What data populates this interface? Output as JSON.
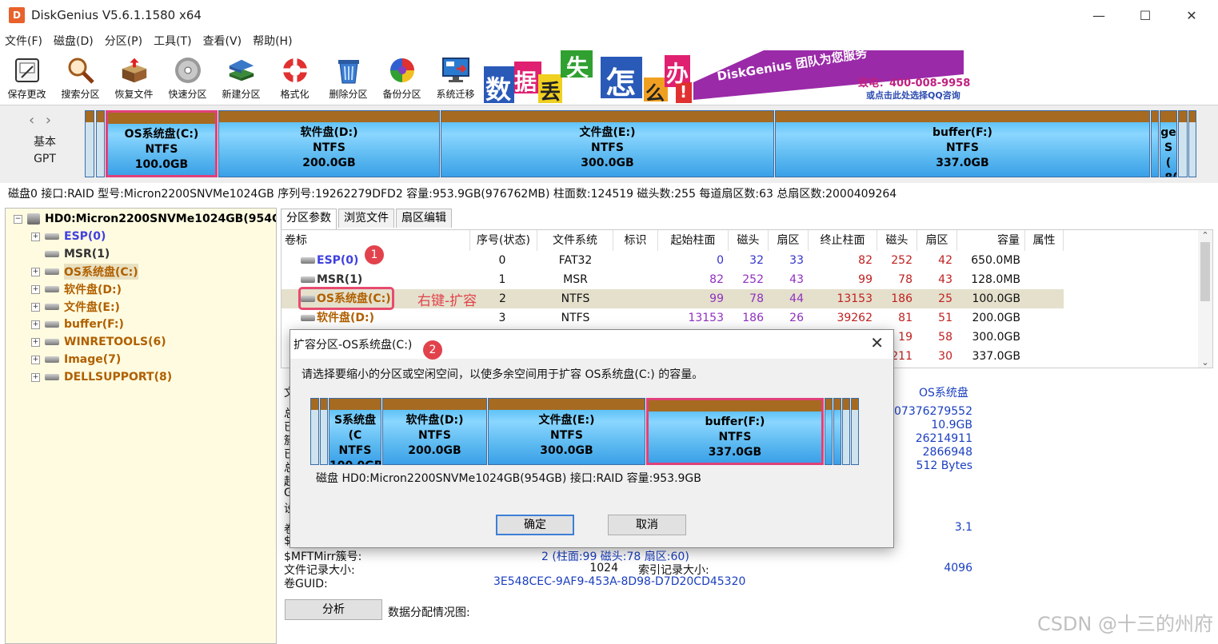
{
  "window": {
    "title": "DiskGenius V5.6.1.1580 x64",
    "logo": "D",
    "controls": [
      "—",
      "☐",
      "✕"
    ]
  },
  "menu": [
    "文件(F)",
    "磁盘(D)",
    "分区(P)",
    "工具(T)",
    "查看(V)",
    "帮助(H)"
  ],
  "toolbar": [
    {
      "label": "保存更改",
      "icon": "save-icon"
    },
    {
      "label": "搜索分区",
      "icon": "magnifier-icon"
    },
    {
      "label": "恢复文件",
      "icon": "restore-box-icon"
    },
    {
      "label": "快速分区",
      "icon": "disc-icon"
    },
    {
      "label": "新建分区",
      "icon": "layers-icon"
    },
    {
      "label": "格式化",
      "icon": "lifebuoy-icon"
    },
    {
      "label": "删除分区",
      "icon": "trash-icon"
    },
    {
      "label": "备份分区",
      "icon": "pie-chart-icon"
    },
    {
      "label": "系统迁移",
      "icon": "monitor-icon"
    }
  ],
  "banner": {
    "chars": [
      "数",
      "据",
      "丢",
      "失",
      "怎",
      "么",
      "办",
      "!"
    ],
    "slogan": "DiskGenius 团队为您服务",
    "phone": "致电：400-008-9958",
    "qq": "或点击此处选择QQ咨询"
  },
  "diskmap": {
    "type_line1": "基本",
    "type_line2": "GPT",
    "partitions": [
      {
        "name": "OS系统盘(C:)",
        "fs": "NTFS",
        "size": "100.0GB"
      },
      {
        "name": "软件盘(D:)",
        "fs": "NTFS",
        "size": "200.0GB"
      },
      {
        "name": "文件盘(E:)",
        "fs": "NTFS",
        "size": "300.0GB"
      },
      {
        "name": "buffer(F:)",
        "fs": "NTFS",
        "size": "337.0GB"
      },
      {
        "name": "ge",
        "fs": "S (",
        "size": ".8("
      }
    ]
  },
  "diskinfo": "磁盘0 接口:RAID  型号:Micron2200SNVMe1024GB  序列号:19262279DFD2  容量:953.9GB(976762MB)  柱面数:124519  磁头数:255  每道扇区数:63  总扇区数:2000409264",
  "tree": {
    "root": "HD0:Micron2200SNVMe1024GB(954G",
    "items": [
      {
        "label": "ESP(0)",
        "color": "#4040e0"
      },
      {
        "label": "MSR(1)",
        "color": "#333333"
      },
      {
        "label": "OS系统盘(C:)",
        "color": "#b06000"
      },
      {
        "label": "软件盘(D:)",
        "color": "#b06000"
      },
      {
        "label": "文件盘(E:)",
        "color": "#b06000"
      },
      {
        "label": "buffer(F:)",
        "color": "#b06000"
      },
      {
        "label": "WINRETOOLS(6)",
        "color": "#b06000"
      },
      {
        "label": "Image(7)",
        "color": "#b06000"
      },
      {
        "label": "DELLSUPPORT(8)",
        "color": "#b06000"
      }
    ]
  },
  "tabs": [
    "分区参数",
    "浏览文件",
    "扇区编辑"
  ],
  "partlist": {
    "headers": [
      "卷标",
      "序号(状态)",
      "文件系统",
      "标识",
      "起始柱面",
      "磁头",
      "扇区",
      "终止柱面",
      "磁头",
      "扇区",
      "容量",
      "属性"
    ],
    "rows": [
      {
        "label": "ESP(0)",
        "color": "#4040e0",
        "idx": "0",
        "fs": "FAT32",
        "sc": "0",
        "sh": "32",
        "ss": "33",
        "ec": "82",
        "eh": "252",
        "es": "42",
        "cap": "650.0MB"
      },
      {
        "label": "MSR(1)",
        "color": "#333333",
        "idx": "1",
        "fs": "MSR",
        "sc": "82",
        "sh": "252",
        "ss": "43",
        "ec": "99",
        "eh": "78",
        "es": "43",
        "cap": "128.0MB"
      },
      {
        "label": "OS系统盘(C:)",
        "color": "#b06000",
        "idx": "2",
        "fs": "NTFS",
        "sc": "99",
        "sh": "78",
        "ss": "44",
        "ec": "13153",
        "eh": "186",
        "es": "25",
        "cap": "100.0GB"
      },
      {
        "label": "软件盘(D:)",
        "color": "#b06000",
        "idx": "3",
        "fs": "NTFS",
        "sc": "13153",
        "sh": "186",
        "ss": "26",
        "ec": "39262",
        "eh": "81",
        "es": "51",
        "cap": "200.0GB"
      },
      {
        "label": "",
        "color": "#b06000",
        "idx": "",
        "fs": "",
        "sc": "",
        "sh": "",
        "ss": "",
        "ec": "",
        "eh": "19",
        "es": "58",
        "cap": "300.0GB"
      },
      {
        "label": "",
        "color": "#b06000",
        "idx": "",
        "fs": "",
        "sc": "",
        "sh": "",
        "ss": "",
        "ec": "",
        "eh": "211",
        "es": "30",
        "cap": "337.0GB"
      }
    ]
  },
  "infopanel": {
    "vol_name": "OS系统盘",
    "values": [
      "07376279552",
      "10.9GB",
      "26214911",
      "2866948",
      "512 Bytes"
    ],
    "version": "3.1",
    "mftmirr_label": "$MFTMirr簇号:",
    "mftmirr_value": "2 (柱面:99 磁头:78 扇区:60)",
    "filerec_label": "文件记录大小:",
    "filerec_value": "1024",
    "index_label": "索引记录大小:",
    "index_value": "4096",
    "guid_label": "卷GUID:",
    "guid_value": "3E548CEC-9AF9-453A-8D98-D7D20CD45320",
    "analyze_button": "分析",
    "alloc_label": "数据分配情况图:",
    "left_chars": [
      "文",
      "总",
      "已",
      "簇",
      "已",
      "总",
      "起",
      "G",
      "设",
      "卷",
      "$"
    ]
  },
  "dialog": {
    "title": "扩容分区-OS系统盘(C:)",
    "message": "请选择要缩小的分区或空闲空间，以使多余空间用于扩容 OS系统盘(C:) 的容量。",
    "partitions": [
      {
        "name": "S系统盘(C",
        "fs": "NTFS",
        "size": "100.0GB"
      },
      {
        "name": "软件盘(D:)",
        "fs": "NTFS",
        "size": "200.0GB"
      },
      {
        "name": "文件盘(E:)",
        "fs": "NTFS",
        "size": "300.0GB"
      },
      {
        "name": "buffer(F:)",
        "fs": "NTFS",
        "size": "337.0GB"
      }
    ],
    "diskinfo": "磁盘 HD0:Micron2200SNVMe1024GB(954GB)  接口:RAID  容量:953.9GB",
    "ok": "确定",
    "cancel": "取消"
  },
  "annotations": {
    "badge1": "1",
    "badge2": "2",
    "text": "右键-扩容"
  },
  "watermark": "CSDN @十三的州府"
}
